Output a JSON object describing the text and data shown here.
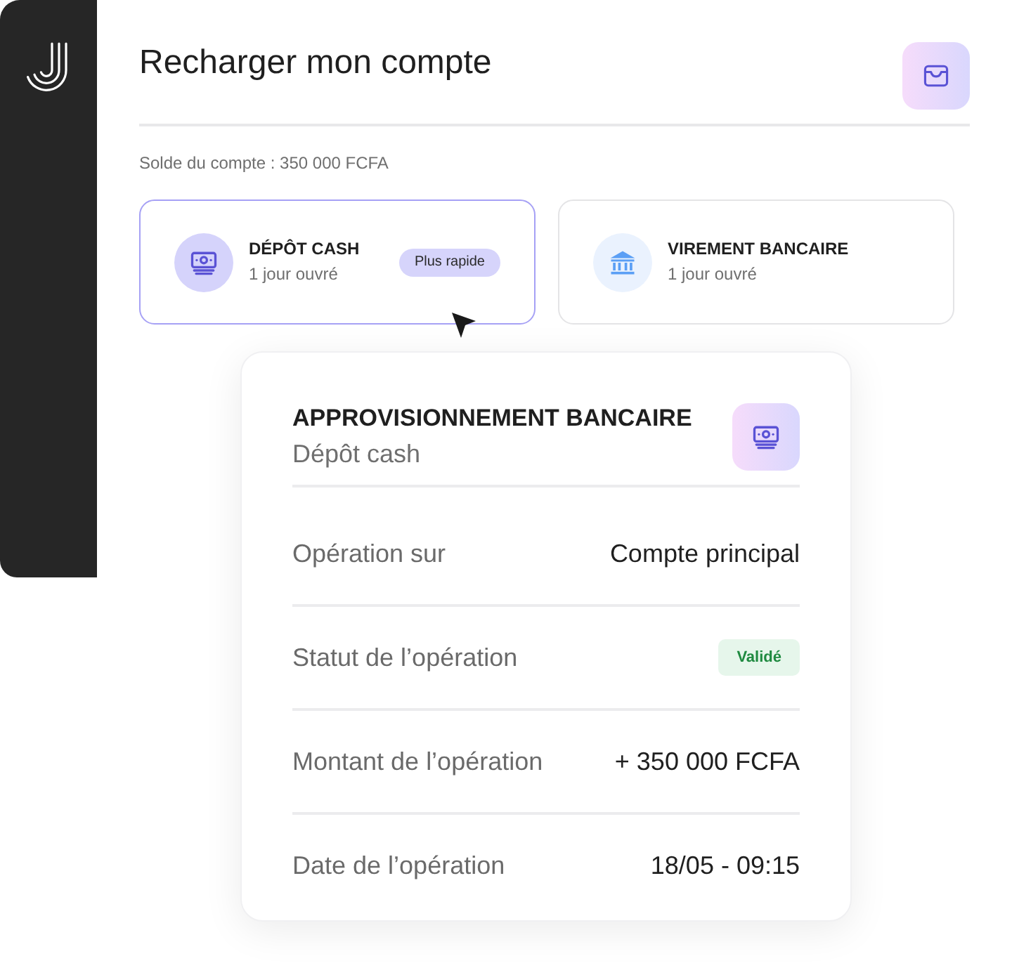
{
  "header": {
    "title": "Recharger mon compte"
  },
  "balance": "Solde du compte : 350 000 FCFA",
  "methods": [
    {
      "kind": "cash",
      "title": "DÉPÔT CASH",
      "subtitle": "1 jour ouvré",
      "badge": "Plus rapide",
      "selected": true
    },
    {
      "kind": "bank",
      "title": "VIREMENT BANCAIRE",
      "subtitle": "1 jour ouvré",
      "selected": false
    }
  ],
  "detail": {
    "title": "APPROVISIONNEMENT BANCAIRE",
    "subtitle": "Dépôt cash",
    "rows": [
      {
        "kind": "text",
        "label": "Opération sur",
        "value": "Compte principal"
      },
      {
        "kind": "status",
        "label": "Statut de l’opération",
        "value": "Validé"
      },
      {
        "kind": "text",
        "label": "Montant de l’opération",
        "value": "+ 350 000 FCFA"
      },
      {
        "kind": "text",
        "label": "Date de l’opération",
        "value": "18/05 - 09:15"
      }
    ]
  }
}
